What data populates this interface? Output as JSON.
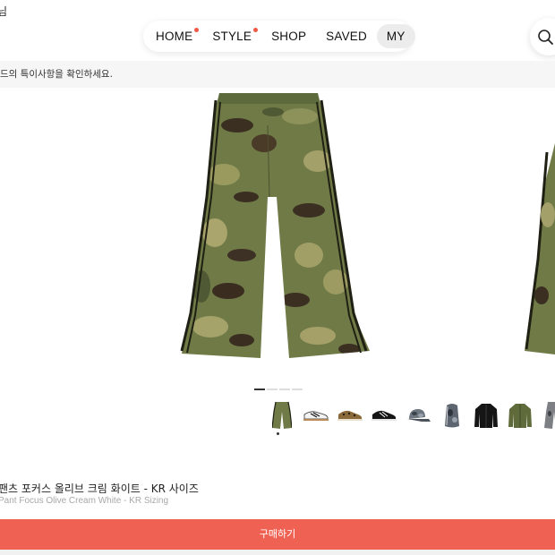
{
  "header": {
    "top_left_text": "님"
  },
  "nav": {
    "items": [
      {
        "label": "HOME",
        "dot": true,
        "active": false
      },
      {
        "label": "STYLE",
        "dot": true,
        "active": false
      },
      {
        "label": "SHOP",
        "dot": false,
        "active": false
      },
      {
        "label": "SAVED",
        "dot": false,
        "active": false
      },
      {
        "label": "MY",
        "dot": false,
        "active": true
      }
    ],
    "search_icon": "search-icon"
  },
  "notice": {
    "text": "드의 특이사항을 확인하세요."
  },
  "gallery": {
    "main_image": "camo-track-pants",
    "slide_count": 4,
    "current_slide": 1,
    "thumbnails": [
      {
        "name": "camo-pants-thumb"
      },
      {
        "name": "sneaker-white-black-thumb"
      },
      {
        "name": "sneaker-leopard-thumb"
      },
      {
        "name": "sneaker-black-thumb"
      },
      {
        "name": "cap-camo-thumb"
      },
      {
        "name": "bag-camo-thumb"
      },
      {
        "name": "black-jacket-thumb"
      },
      {
        "name": "olive-jacket-thumb"
      },
      {
        "name": "grey-pants-thumb"
      }
    ]
  },
  "product": {
    "title_ko": "팬츠 포커스 올리브 크림 화이트 - KR 사이즈",
    "title_en": "Pant Focus Olive Cream White - KR Sizing"
  },
  "actions": {
    "buy_label": "구매하기"
  },
  "colors": {
    "accent": "#ef6253",
    "nav_dot": "#ef5a44",
    "camo_base": "#6f7a47"
  }
}
